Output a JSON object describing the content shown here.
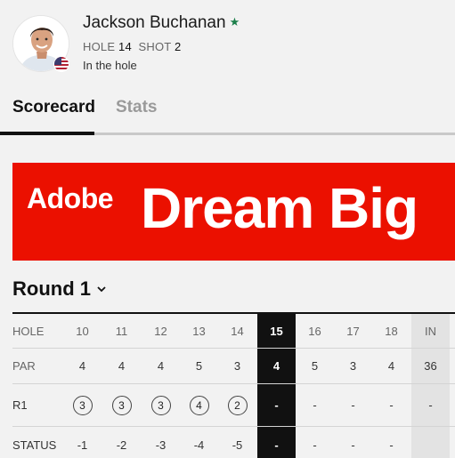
{
  "player": {
    "name": "Jackson Buchanan",
    "favorite_icon": "star-icon",
    "hole_label": "HOLE",
    "hole_value": "14",
    "shot_label": "SHOT",
    "shot_value": "2",
    "status": "In the hole",
    "country_flag": "us-flag-icon",
    "star_color": "#1b7f4a"
  },
  "tabs": [
    {
      "label": "Scorecard",
      "active": true
    },
    {
      "label": "Stats",
      "active": false
    }
  ],
  "ad": {
    "brand": "Adobe",
    "tagline": "Dream Big",
    "background": "#eb1000"
  },
  "round": {
    "title": "Round 1",
    "chevron_icon": "chevron-down-icon"
  },
  "scorecard": {
    "rows": [
      {
        "label": "HOLE",
        "cells": [
          "10",
          "11",
          "12",
          "13",
          "14",
          "15",
          "16",
          "17",
          "18",
          "IN"
        ]
      },
      {
        "label": "PAR",
        "cells": [
          "4",
          "4",
          "4",
          "5",
          "3",
          "4",
          "5",
          "3",
          "4",
          "36"
        ]
      },
      {
        "label": "R1",
        "cells": [
          "3",
          "3",
          "3",
          "4",
          "2",
          "-",
          "-",
          "-",
          "-",
          "-"
        ],
        "circled": [
          true,
          true,
          true,
          true,
          true,
          false,
          false,
          false,
          false,
          false
        ]
      },
      {
        "label": "STATUS",
        "cells": [
          "-1",
          "-2",
          "-3",
          "-4",
          "-5",
          "-",
          "-",
          "-",
          "-",
          ""
        ]
      }
    ],
    "current_col_index": 5,
    "total_col_index": 9,
    "current_color": "#111111",
    "total_col_color": "#e3e3e3"
  }
}
